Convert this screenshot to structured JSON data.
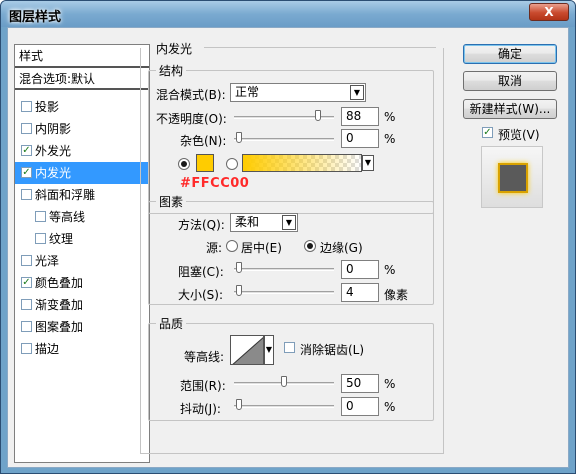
{
  "window": {
    "title": "图层样式",
    "close_label": "X"
  },
  "styles_panel": {
    "header": "样式",
    "blend_options": "混合选项:默认",
    "items": [
      {
        "label": "投影",
        "checked": false
      },
      {
        "label": "内阴影",
        "checked": false
      },
      {
        "label": "外发光",
        "checked": true
      },
      {
        "label": "内发光",
        "checked": true,
        "selected": true
      },
      {
        "label": "斜面和浮雕",
        "checked": false
      },
      {
        "label": "等高线",
        "checked": false,
        "sub": true
      },
      {
        "label": "纹理",
        "checked": false,
        "sub": true
      },
      {
        "label": "光泽",
        "checked": false
      },
      {
        "label": "颜色叠加",
        "checked": true
      },
      {
        "label": "渐变叠加",
        "checked": false
      },
      {
        "label": "图案叠加",
        "checked": false
      },
      {
        "label": "描边",
        "checked": false
      }
    ],
    "check_glyph": "✓"
  },
  "inner_glow": {
    "title": "内发光",
    "structure": {
      "label": "结构",
      "blend_mode_label": "混合模式(B):",
      "blend_mode_value": "正常",
      "opacity_label": "不透明度(O):",
      "opacity_value": "88",
      "opacity_unit": "%",
      "opacity_fraction": 0.88,
      "noise_label": "杂色(N):",
      "noise_value": "0",
      "noise_unit": "%",
      "noise_fraction": 0.0,
      "glow_color": "#FFCC00",
      "color_annotation": "#FFCC00"
    },
    "elements": {
      "label": "图素",
      "technique_label": "方法(Q):",
      "technique_value": "柔和",
      "source_label": "源:",
      "source_center_label": "居中(E)",
      "source_edge_label": "边缘(G)",
      "choke_label": "阻塞(C):",
      "choke_value": "0",
      "choke_unit": "%",
      "choke_fraction": 0.0,
      "size_label": "大小(S):",
      "size_value": "4",
      "size_unit": "像素"
    },
    "quality": {
      "label": "品质",
      "contour_label": "等高线:",
      "anti_alias_label": "消除锯齿(L)",
      "range_label": "范围(R):",
      "range_value": "50",
      "range_unit": "%",
      "range_fraction": 0.5,
      "jitter_label": "抖动(J):",
      "jitter_value": "0",
      "jitter_unit": "%",
      "jitter_fraction": 0.0
    }
  },
  "buttons": {
    "ok": "确定",
    "cancel": "取消",
    "new_style": "新建样式(W)...",
    "preview_label": "预览(V)",
    "preview_checked": true
  },
  "colors": {
    "accent": "#3399ff",
    "glow": "#FFCC00",
    "preview_fill": "#5a5a5a"
  }
}
